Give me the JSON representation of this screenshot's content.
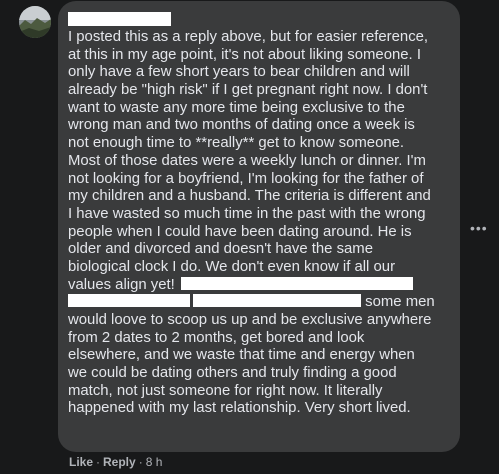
{
  "comment": {
    "author_avatar": "avatar-icon",
    "lines": [
      "I posted this as a reply above, but for easier reference,",
      "at this in my age point, it's not about liking someone. I",
      "only have a few short years to bear children and will",
      "already be \"high risk\" if I get pregnant right now. I don't",
      "want to waste any more time being exclusive to the",
      "wrong man and two months of dating once a week is",
      "not enough time to **really** get to know someone.",
      "Most of those dates were a weekly lunch or dinner. I'm",
      "not looking for a boyfriend, I'm looking for the father of",
      "my children and a husband. The criteria is different and",
      "I have wasted so much time in the past with the wrong",
      "people when I could have been dating around. He is",
      "older and divorced and doesn't have the same",
      "biological clock I do. We don't even know if all our",
      "values align yet!",
      "some men",
      "would loove to scoop us up and be exclusive anywhere",
      "from 2 dates to 2 months, get bored and look",
      "elsewhere, and we waste that time and energy when",
      "we could be dating others and truly finding a good",
      "match, not just someone for right now. It literally",
      "happened with my last relationship. Very short lived."
    ]
  },
  "actions": {
    "like": "Like",
    "separator": "·",
    "reply": "Reply",
    "time": "8 h"
  },
  "more_options": "•••"
}
